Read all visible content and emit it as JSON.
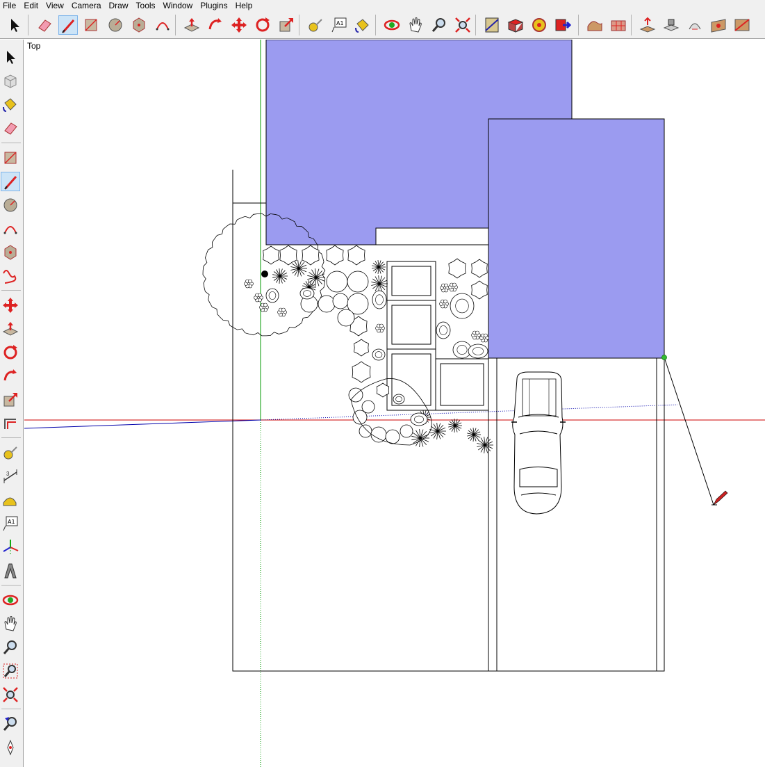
{
  "menu": [
    "File",
    "Edit",
    "View",
    "Camera",
    "Draw",
    "Tools",
    "Window",
    "Plugins",
    "Help"
  ],
  "top_tools": [
    {
      "name": "select-tool-icon"
    },
    {
      "name": "eraser-tool-icon"
    },
    {
      "name": "line-tool-icon",
      "active": true
    },
    {
      "name": "rectangle-tool-icon"
    },
    {
      "name": "circle-tool-icon"
    },
    {
      "name": "polygon-tool-icon"
    },
    {
      "name": "arc-tool-icon"
    },
    {
      "name": "push-pull-tool-icon"
    },
    {
      "name": "follow-me-tool-icon"
    },
    {
      "name": "move-tool-icon"
    },
    {
      "name": "rotate-tool-icon"
    },
    {
      "name": "scale-tool-icon"
    },
    {
      "name": "tape-measure-tool-icon"
    },
    {
      "name": "text-tool-icon"
    },
    {
      "name": "paint-bucket-tool-icon"
    },
    {
      "name": "orbit-tool-icon"
    },
    {
      "name": "pan-tool-icon"
    },
    {
      "name": "zoom-tool-icon"
    },
    {
      "name": "zoom-extents-tool-icon"
    },
    {
      "name": "model-info-icon"
    },
    {
      "name": "components-icon"
    },
    {
      "name": "get-models-icon"
    },
    {
      "name": "share-model-icon"
    },
    {
      "name": "sandbox-from-contours-icon"
    },
    {
      "name": "sandbox-from-scratch-icon"
    },
    {
      "name": "smoove-tool-icon"
    },
    {
      "name": "stamp-tool-icon"
    },
    {
      "name": "drape-tool-icon"
    },
    {
      "name": "add-detail-tool-icon"
    },
    {
      "name": "flip-edge-tool-icon"
    }
  ],
  "left_tools": [
    {
      "name": "select-tool-icon"
    },
    {
      "name": "make-component-tool-icon"
    },
    {
      "name": "paint-bucket-tool-icon"
    },
    {
      "name": "eraser-tool-icon"
    },
    {
      "name": "rectangle-tool-icon"
    },
    {
      "name": "line-tool-icon",
      "active": true
    },
    {
      "name": "circle-tool-icon"
    },
    {
      "name": "arc-tool-icon"
    },
    {
      "name": "polygon-tool-icon"
    },
    {
      "name": "freehand-tool-icon"
    },
    {
      "name": "move-tool-icon"
    },
    {
      "name": "push-pull-tool-icon"
    },
    {
      "name": "rotate-tool-icon"
    },
    {
      "name": "follow-me-tool-icon"
    },
    {
      "name": "scale-tool-icon"
    },
    {
      "name": "offset-tool-icon"
    },
    {
      "name": "tape-measure-tool-icon"
    },
    {
      "name": "dimension-tool-icon"
    },
    {
      "name": "protractor-tool-icon"
    },
    {
      "name": "text-tool-icon"
    },
    {
      "name": "axes-tool-icon"
    },
    {
      "name": "3d-text-tool-icon"
    },
    {
      "name": "orbit-tool-icon"
    },
    {
      "name": "pan-tool-icon"
    },
    {
      "name": "zoom-tool-icon"
    },
    {
      "name": "zoom-window-tool-icon"
    },
    {
      "name": "zoom-extents-tool-icon"
    },
    {
      "name": "previous-view-tool-icon"
    },
    {
      "name": "position-camera-tool-icon"
    }
  ],
  "viewport": {
    "view_label": "Top",
    "colors": {
      "building_fill": "#9b9bf0",
      "red_axis": "#cc0000",
      "green_axis": "#009900",
      "blue_axis": "#0000aa",
      "endpoint": "#33bb33",
      "pencil": "#cc2222",
      "toolbar_bg": "#f0f0f0",
      "active_tool": "#cce4f7"
    }
  }
}
